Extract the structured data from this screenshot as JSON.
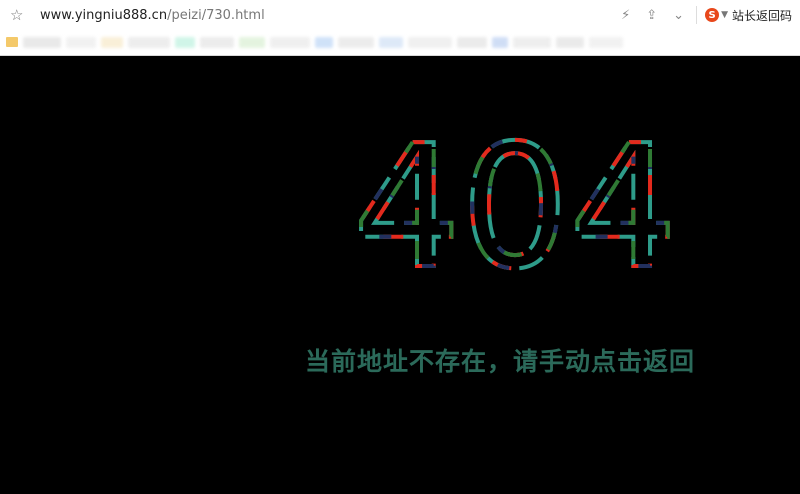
{
  "browser": {
    "url_host": "www.yingniu888.cn",
    "url_path": "/peizi/730.html",
    "toolbar_label": "站长返回码",
    "engine_logo": "S",
    "icons": [
      "star-icon",
      "lightning-icon",
      "share-icon",
      "chevron-down-icon",
      "search-engine-logo-icon"
    ]
  },
  "bookmarks": {
    "colors": [
      "#e0e0e0",
      "#ececec",
      "#f7e9c8",
      "#e6e6e6",
      "#bdf1df",
      "#e4e4e4",
      "#d9efd2",
      "#e9e9e9",
      "#bcd6f6",
      "#e5e5e5",
      "#cfe0f5",
      "#eaeaea",
      "#e3e3e3",
      "#bcd0f2",
      "#e7e7e7",
      "#e2e2e2",
      "#ececec"
    ]
  },
  "error_page": {
    "code": "404",
    "message": "当前地址不存在，请手动点击返回",
    "colors": {
      "teal": "#2e9c8a",
      "red": "#e32a1d",
      "navy": "#22305e",
      "green": "#2f7a34",
      "message": "#2b6a5a"
    }
  }
}
